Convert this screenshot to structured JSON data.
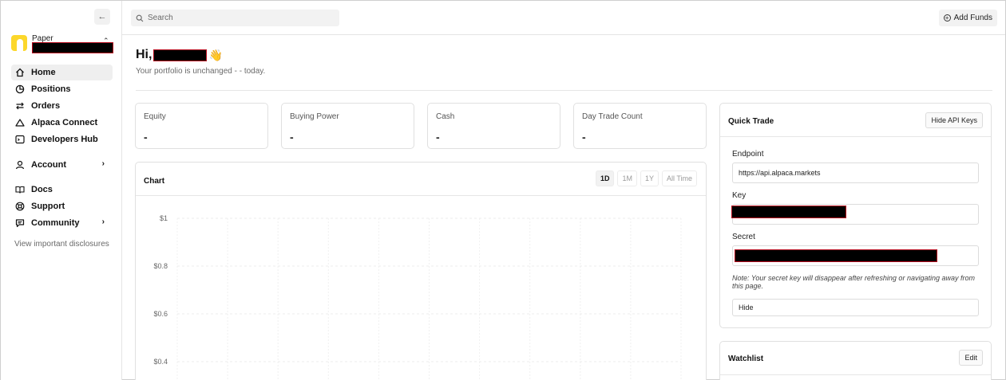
{
  "sidebar": {
    "collapse_icon": "arrow-left-icon",
    "account_type": "Paper",
    "items": [
      {
        "label": "Home",
        "icon": "home-icon",
        "active": true
      },
      {
        "label": "Positions",
        "icon": "positions-icon"
      },
      {
        "label": "Orders",
        "icon": "swap-icon"
      },
      {
        "label": "Alpaca Connect",
        "icon": "triangle-icon"
      },
      {
        "label": "Developers Hub",
        "icon": "terminal-icon"
      },
      {
        "label": "Account",
        "icon": "user-icon",
        "chevron": "›"
      },
      {
        "label": "Docs",
        "icon": "book-icon"
      },
      {
        "label": "Support",
        "icon": "lifebuoy-icon"
      },
      {
        "label": "Community",
        "icon": "chat-icon",
        "chevron": "›"
      }
    ],
    "disclosures": "View important disclosures"
  },
  "topbar": {
    "search_placeholder": "Search",
    "add_funds": "Add Funds"
  },
  "greeting": {
    "hi": "Hi,",
    "emoji": "👋",
    "subtitle": "Your portfolio is unchanged - - today."
  },
  "stats": [
    {
      "label": "Equity",
      "value": "-"
    },
    {
      "label": "Buying Power",
      "value": "-"
    },
    {
      "label": "Cash",
      "value": "-"
    },
    {
      "label": "Day Trade Count",
      "value": "-"
    }
  ],
  "chart": {
    "title": "Chart",
    "ranges": [
      "1D",
      "1M",
      "1Y",
      "All Time"
    ],
    "active_range": "1D"
  },
  "chart_data": {
    "type": "line",
    "title": "Chart",
    "xlabel": "",
    "ylabel": "",
    "y_ticks": [
      "$1",
      "$0.8",
      "$0.6",
      "$0.4"
    ],
    "ylim": [
      0.4,
      1
    ],
    "grid": true,
    "series": []
  },
  "quick_trade": {
    "title": "Quick Trade",
    "hide_api_keys": "Hide API Keys",
    "endpoint_label": "Endpoint",
    "endpoint_value": "https://api.alpaca.markets",
    "key_label": "Key",
    "secret_label": "Secret",
    "note": "Note: Your secret key will disappear after refreshing or navigating away from this page.",
    "hide_button": "Hide"
  },
  "watchlist": {
    "title": "Watchlist",
    "edit": "Edit"
  },
  "colors": {
    "logo": "#fcd72b",
    "redaction_border": "#b60a1c"
  }
}
